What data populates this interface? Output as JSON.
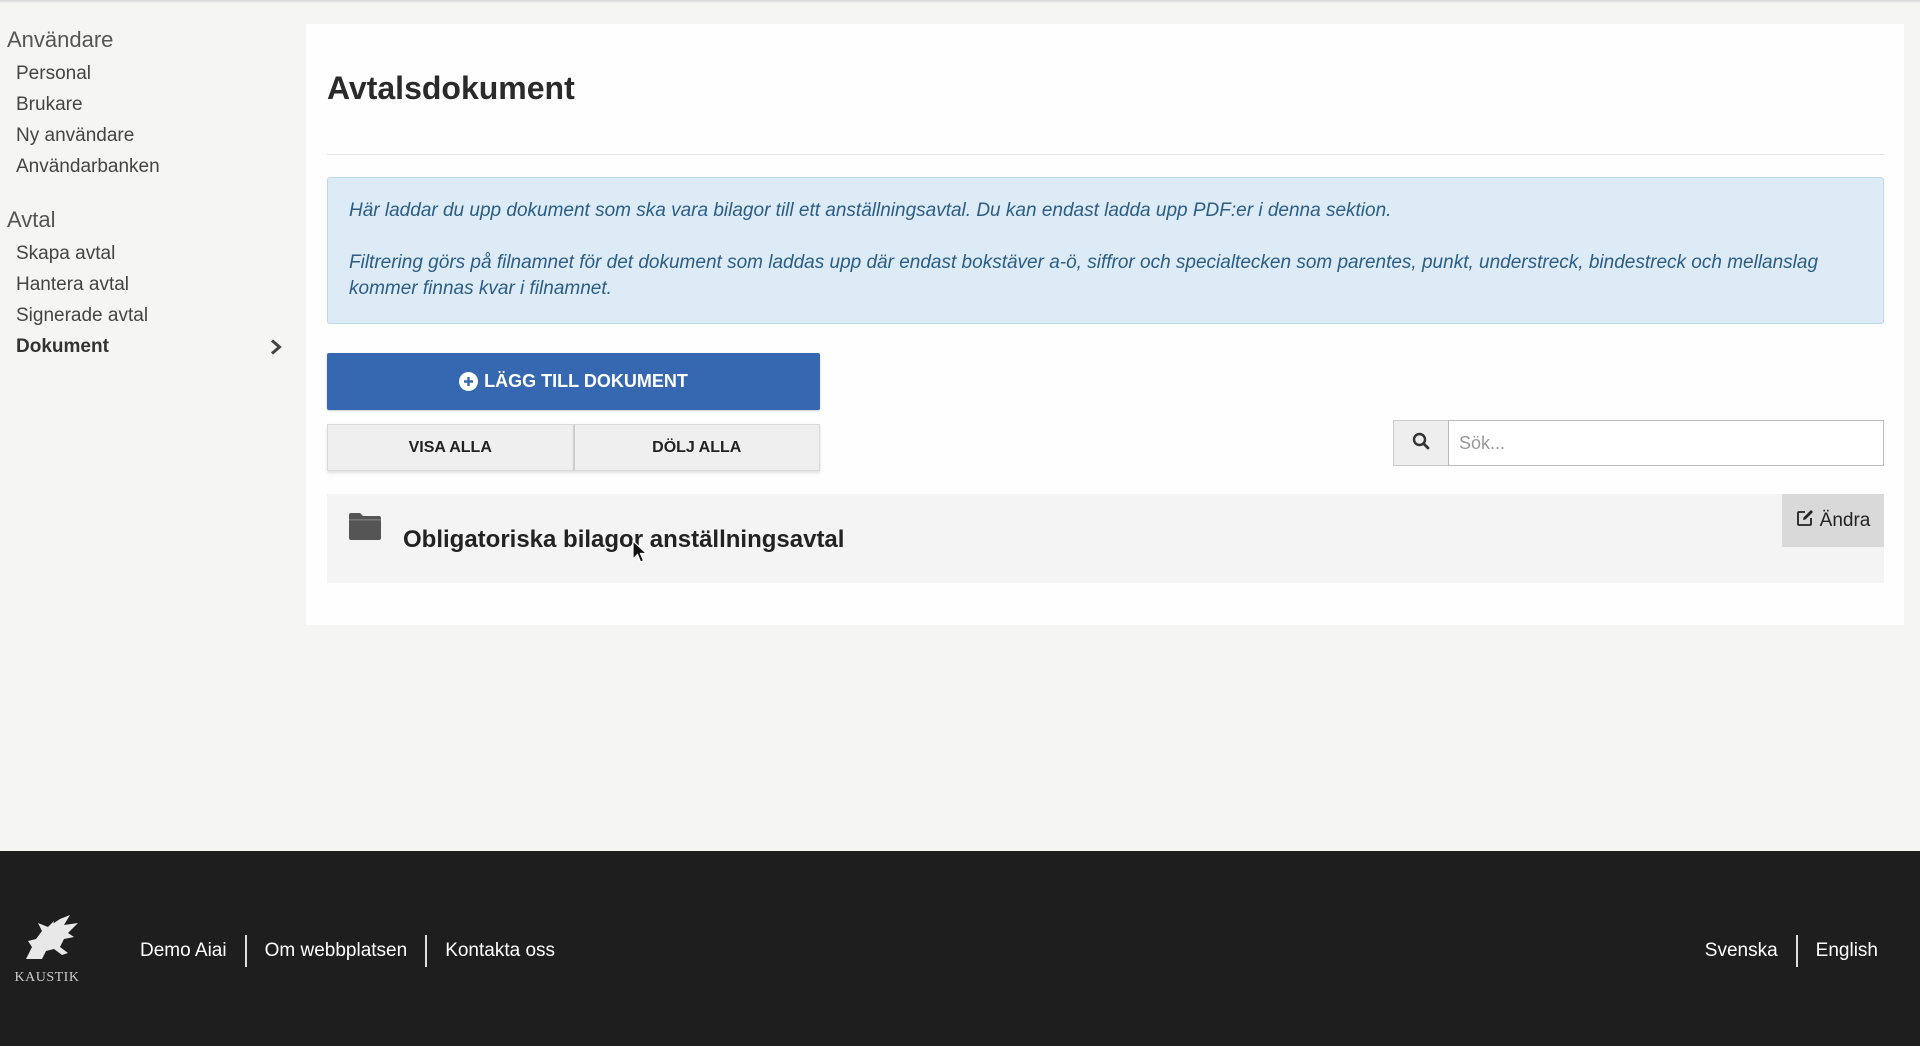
{
  "sidebar": {
    "groups": [
      {
        "heading": "Användare",
        "items": [
          "Personal",
          "Brukare",
          "Ny användare",
          "Användarbanken"
        ]
      },
      {
        "heading": "Avtal",
        "items": [
          "Skapa avtal",
          "Hantera avtal",
          "Signerade avtal",
          "Dokument"
        ]
      }
    ],
    "active_item": "Dokument"
  },
  "main": {
    "title": "Avtalsdokument",
    "info_paragraphs": [
      "Här laddar du upp dokument som ska vara bilagor till ett anställningsavtal. Du kan endast ladda upp PDF:er i denna sektion.",
      "Filtrering görs på filnamnet för det dokument som laddas upp där endast bokstäver a-ö, siffror och specialtecken som parentes, punkt, understreck, bindestreck och mellanslag kommer finnas kvar i filnamnet."
    ],
    "add_button_label": "LÄGG TILL DOKUMENT",
    "show_all_label": "VISA ALLA",
    "hide_all_label": "DÖLJ ALLA",
    "search": {
      "placeholder": "Sök...",
      "value": ""
    },
    "folders": [
      {
        "title": "Obligatoriska bilagor anställningsavtal",
        "edit_label": "Ändra"
      }
    ]
  },
  "footer": {
    "logo_text": "KAUSTIK",
    "links": [
      "Demo Aiai",
      "Om webbplatsen",
      "Kontakta oss"
    ],
    "languages": [
      "Svenska",
      "English"
    ]
  },
  "colors": {
    "primary": "#3568b0",
    "info_bg": "#dcebf5",
    "info_text": "#2c5d84",
    "footer_bg": "#1e1e1e"
  }
}
